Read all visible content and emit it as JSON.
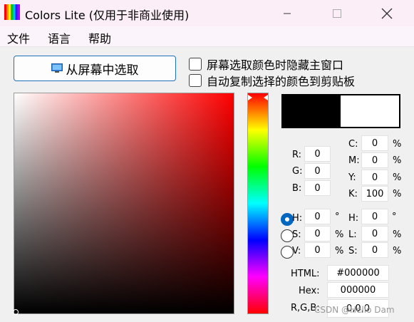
{
  "window": {
    "title": "Colors Lite (仅用于非商业使用)"
  },
  "menu": {
    "items": [
      "文件",
      "语言",
      "帮助"
    ]
  },
  "pick": {
    "label": "从屏幕中选取"
  },
  "options": [
    {
      "label": "屏幕选取颜色时隐藏主窗口",
      "checked": false
    },
    {
      "label": "自动复制选择的颜色到剪贴板",
      "checked": false
    }
  ],
  "colors": {
    "current": "#000000",
    "previous": "#ffffff",
    "accent": "#0067c0"
  },
  "rgb": {
    "r_label": "R:",
    "g_label": "G:",
    "b_label": "B:",
    "r": "0",
    "g": "0",
    "b": "0"
  },
  "cmyk": {
    "c_label": "C:",
    "m_label": "M:",
    "y_label": "Y:",
    "k_label": "K:",
    "c": "0",
    "m": "0",
    "y": "0",
    "k": "100",
    "unit": "%"
  },
  "hsv": {
    "h_label": "H:",
    "s_label": "S:",
    "v_label": "V:",
    "h": "0",
    "s": "0",
    "v": "0",
    "h_unit": "°",
    "unit": "%",
    "selected": "H"
  },
  "hsl": {
    "h_label": "H:",
    "l_label": "L:",
    "s_label": "S:",
    "h": "0",
    "l": "0",
    "s": "0",
    "h_unit": "°",
    "unit": "%"
  },
  "html_code": {
    "label": "HTML:",
    "value": "#000000"
  },
  "hex_code": {
    "label": "Hex:",
    "value": "000000"
  },
  "rgb_code": {
    "label": "R,G,B:",
    "value": "0,0,0"
  },
  "watermark": "CSDN @Hello Dam"
}
